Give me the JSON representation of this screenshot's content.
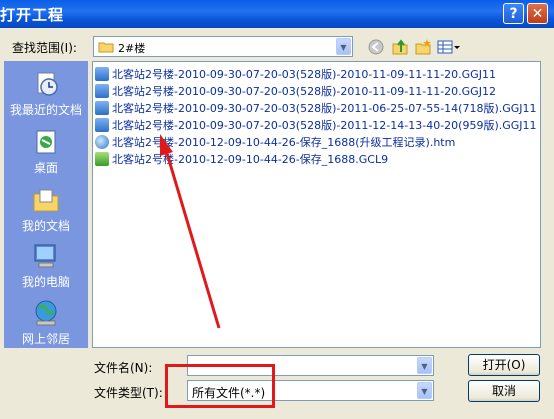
{
  "window": {
    "title": "打开工程",
    "help_label": "?",
    "close_label": "✕"
  },
  "lookin": {
    "label": "查找范围(I):",
    "value": "2#楼"
  },
  "places": [
    {
      "label": "我最近的文档",
      "icon": "recent-documents-icon"
    },
    {
      "label": "桌面",
      "icon": "desktop-icon"
    },
    {
      "label": "我的文档",
      "icon": "my-documents-icon"
    },
    {
      "label": "我的电脑",
      "icon": "my-computer-icon"
    },
    {
      "label": "网上邻居",
      "icon": "network-places-icon"
    }
  ],
  "files": [
    {
      "name": "北客站2号楼-2010-09-30-07-20-03(528版)-2010-11-09-11-11-20.GGJ11",
      "icon": "ggj-file-icon"
    },
    {
      "name": "北客站2号楼-2010-09-30-07-20-03(528版)-2010-11-09-11-11-20.GGJ12",
      "icon": "ggj-file-icon"
    },
    {
      "name": "北客站2号楼-2010-09-30-07-20-03(528版)-2011-06-25-07-55-14(718版).GGJ11",
      "icon": "ggj-file-icon"
    },
    {
      "name": "北客站2号楼-2010-09-30-07-20-03(528版)-2011-12-14-13-40-20(959版).GGJ11",
      "icon": "ggj-file-icon"
    },
    {
      "name": "北客站2号楼-2010-12-09-10-44-26-保存_1688(升级工程记录).htm",
      "icon": "htm-file-icon"
    },
    {
      "name": "北客站2号楼-2010-12-09-10-44-26-保存_1688.GCL9",
      "icon": "gcl-file-icon"
    }
  ],
  "filename": {
    "label": "文件名(N):",
    "value": ""
  },
  "filetype": {
    "label": "文件类型(T):",
    "value": "所有文件(*.*)"
  },
  "buttons": {
    "open": "打开(O)",
    "cancel": "取消"
  },
  "colors": {
    "title_bar": "#0a5de8",
    "places_bar": "#7a96df",
    "annotation": "#e0191b"
  }
}
